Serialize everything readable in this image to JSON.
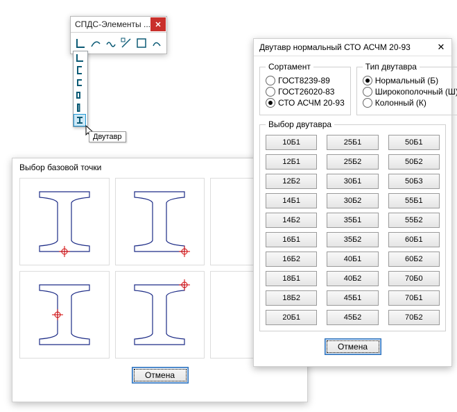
{
  "toolbar": {
    "title": "СПДС-Элементы ...",
    "tooltip": "Двутавр"
  },
  "dlgLeft": {
    "title": "Выбор базовой точки",
    "cancel": "Отмена"
  },
  "dlgRight": {
    "title": "Двутавр нормальный СТО АСЧМ 20-93",
    "sortGroup": "Сортамент",
    "sortOptions": [
      "ГОСТ8239-89",
      "ГОСТ26020-83",
      "СТО АСЧМ 20-93"
    ],
    "sortSelectedIndex": 2,
    "typeGroup": "Тип двутавра",
    "typeOptions": [
      "Нормальный (Б)",
      "Широкополочный (Ш)",
      "Колонный (К)"
    ],
    "typeSelectedIndex": 0,
    "selectGroup": "Выбор двутавра",
    "sizes": [
      "10Б1",
      "25Б1",
      "50Б1",
      "12Б1",
      "25Б2",
      "50Б2",
      "12Б2",
      "30Б1",
      "50Б3",
      "14Б1",
      "30Б2",
      "55Б1",
      "14Б2",
      "35Б1",
      "55Б2",
      "16Б1",
      "35Б2",
      "60Б1",
      "16Б2",
      "40Б1",
      "60Б2",
      "18Б1",
      "40Б2",
      "70Б0",
      "18Б2",
      "45Б1",
      "70Б1",
      "20Б1",
      "45Б2",
      "70Б2"
    ],
    "cancel": "Отмена"
  }
}
